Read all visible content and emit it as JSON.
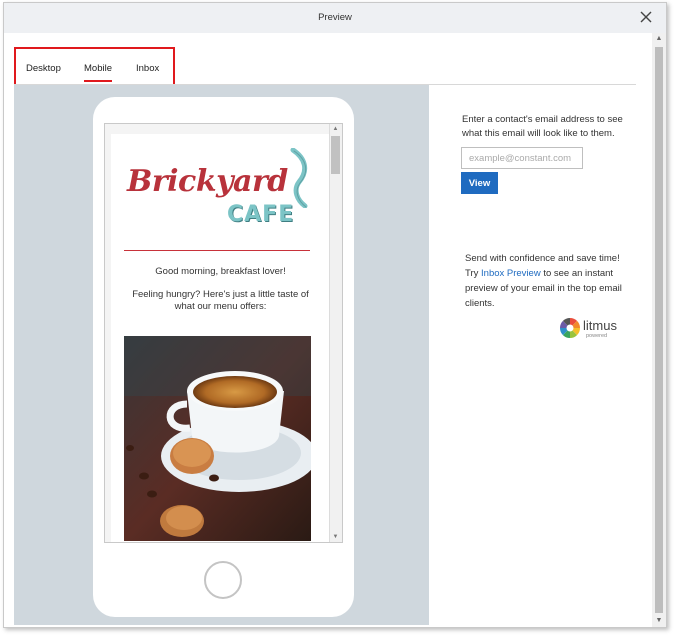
{
  "dialog": {
    "title": "Preview",
    "close_icon": "close-icon"
  },
  "tabs": [
    {
      "label": "Desktop"
    },
    {
      "label": "Mobile",
      "active": true
    },
    {
      "label": "Inbox"
    }
  ],
  "email_preview": {
    "logo_top": "Brickyard",
    "logo_bottom": "CAFE",
    "greeting": "Good morning, breakfast lover!",
    "intro": "Feeling hungry? Here's just a little taste of what our menu offers:",
    "image": "coffee-cup-with-cookies"
  },
  "side_panel": {
    "description": "Enter a contact's email address to see what this email will look like to them.",
    "email_placeholder": "example@constant.com",
    "view_label": "View",
    "promo_before": "Send with confidence and save time! Try ",
    "promo_link": "Inbox Preview",
    "promo_after": " to see an instant preview of your email in the top email clients.",
    "litmus_label": "litmus",
    "litmus_sub": "powered"
  },
  "colors": {
    "accent_red": "#e0191d",
    "button_blue": "#1f6bc0",
    "logo_red": "#b8323b",
    "logo_teal": "#7cc4c6"
  }
}
